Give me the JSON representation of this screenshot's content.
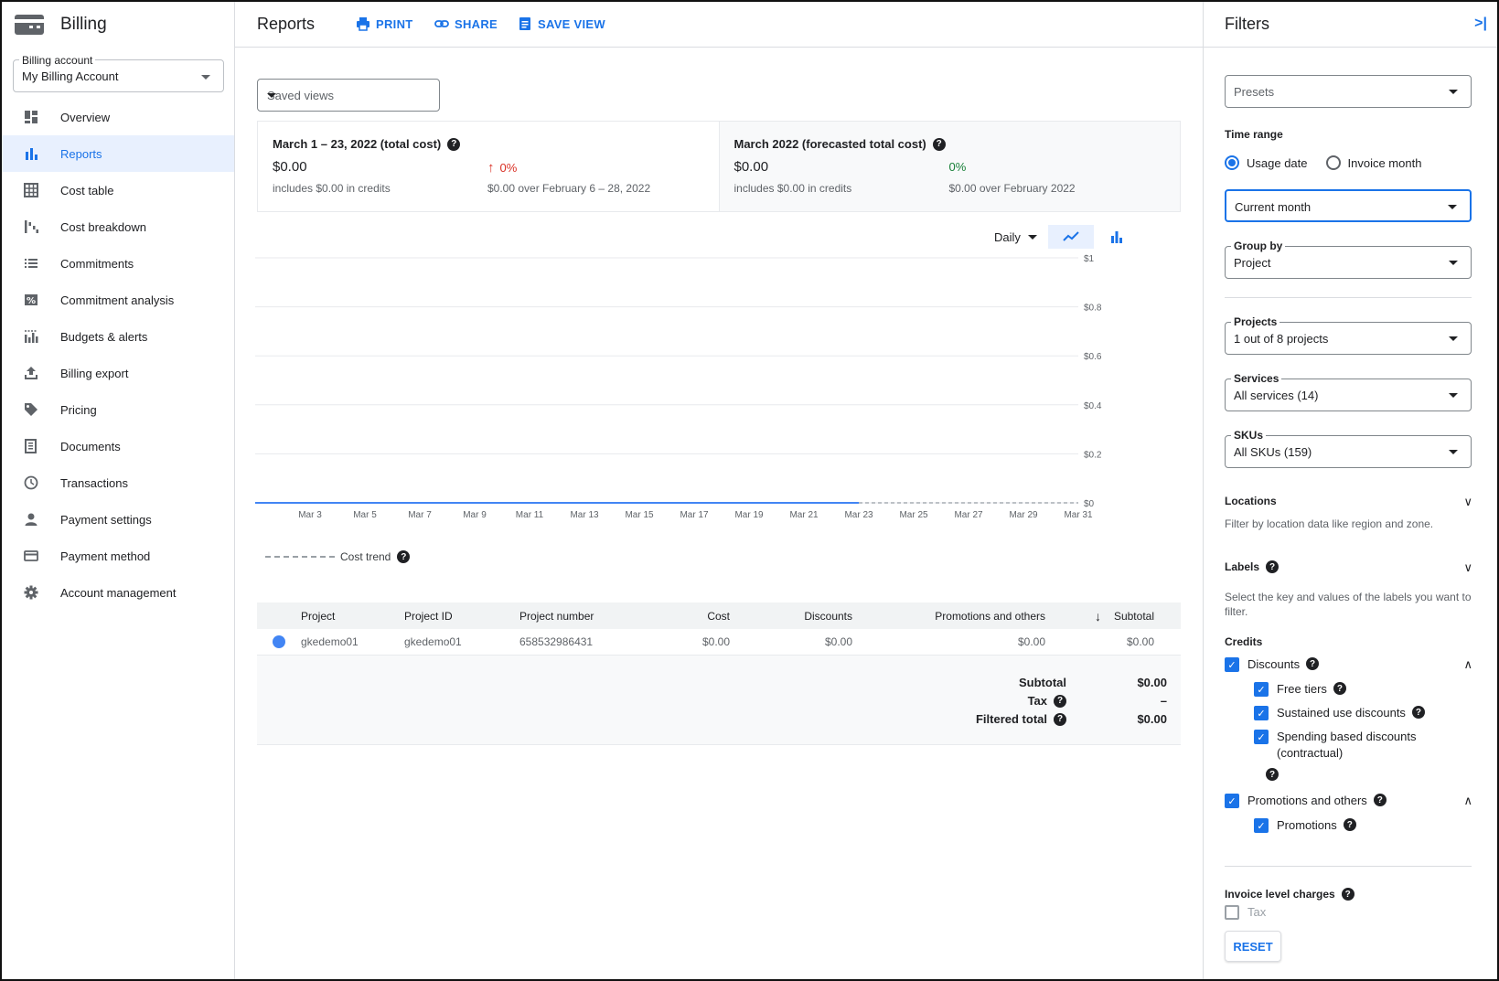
{
  "app": {
    "title": "Billing"
  },
  "billing_account": {
    "label": "Billing account",
    "value": "My Billing Account"
  },
  "sidebar": {
    "items": [
      {
        "label": "Overview",
        "icon": "dashboard-icon"
      },
      {
        "label": "Reports",
        "icon": "bar-chart-icon",
        "active": true
      },
      {
        "label": "Cost table",
        "icon": "table-icon"
      },
      {
        "label": "Cost breakdown",
        "icon": "waterfall-icon"
      },
      {
        "label": "Commitments",
        "icon": "list-icon"
      },
      {
        "label": "Commitment analysis",
        "icon": "percent-icon"
      },
      {
        "label": "Budgets & alerts",
        "icon": "budget-icon"
      },
      {
        "label": "Billing export",
        "icon": "upload-icon"
      },
      {
        "label": "Pricing",
        "icon": "tag-icon"
      },
      {
        "label": "Documents",
        "icon": "document-icon"
      },
      {
        "label": "Transactions",
        "icon": "clock-icon"
      },
      {
        "label": "Payment settings",
        "icon": "person-icon"
      },
      {
        "label": "Payment method",
        "icon": "credit-card-icon"
      },
      {
        "label": "Account management",
        "icon": "gear-icon"
      }
    ]
  },
  "header": {
    "title": "Reports",
    "print_label": "PRINT",
    "share_label": "SHARE",
    "save_view_label": "SAVE VIEW"
  },
  "saved_views": {
    "placeholder": "Saved views"
  },
  "summary": {
    "total": {
      "title": "March 1 – 23, 2022 (total cost)",
      "cost": "$0.00",
      "credits": "includes $0.00 in credits",
      "change": "0%",
      "compare": "$0.00 over February 6 – 28, 2022"
    },
    "forecast": {
      "title": "March 2022 (forecasted total cost)",
      "cost": "$0.00",
      "credits": "includes $0.00 in credits",
      "change": "0%",
      "compare": "$0.00 over February 2022"
    }
  },
  "chart_controls": {
    "granularity": "Daily"
  },
  "chart_data": {
    "type": "line",
    "x": [
      "Mar 1",
      "Mar 2",
      "Mar 3",
      "Mar 4",
      "Mar 5",
      "Mar 6",
      "Mar 7",
      "Mar 8",
      "Mar 9",
      "Mar 10",
      "Mar 11",
      "Mar 12",
      "Mar 13",
      "Mar 14",
      "Mar 15",
      "Mar 16",
      "Mar 17",
      "Mar 18",
      "Mar 19",
      "Mar 20",
      "Mar 21",
      "Mar 22",
      "Mar 23",
      "Mar 24",
      "Mar 25",
      "Mar 26",
      "Mar 27",
      "Mar 28",
      "Mar 29",
      "Mar 30",
      "Mar 31"
    ],
    "x_tick_labels": [
      "Mar 3",
      "Mar 5",
      "Mar 7",
      "Mar 9",
      "Mar 11",
      "Mar 13",
      "Mar 15",
      "Mar 17",
      "Mar 19",
      "Mar 21",
      "Mar 23",
      "Mar 25",
      "Mar 27",
      "Mar 29",
      "Mar 31"
    ],
    "y_tick_labels": [
      "$1",
      "$0.8",
      "$0.6",
      "$0.4",
      "$0.2",
      "$0"
    ],
    "ylim": [
      0,
      1
    ],
    "series": [
      {
        "values": [
          0,
          0,
          0,
          0,
          0,
          0,
          0,
          0,
          0,
          0,
          0,
          0,
          0,
          0,
          0,
          0,
          0,
          0,
          0,
          0,
          0,
          0,
          0
        ],
        "color": "#4285f4",
        "style": "solid"
      },
      {
        "name": "Cost trend",
        "values": [
          null,
          null,
          null,
          null,
          null,
          null,
          null,
          null,
          null,
          null,
          null,
          null,
          null,
          null,
          null,
          null,
          null,
          null,
          null,
          null,
          null,
          null,
          0,
          0,
          0,
          0,
          0,
          0,
          0,
          0,
          0
        ],
        "color": "#bdc1c6",
        "style": "dashed"
      }
    ],
    "grid": true,
    "legend": "bottom-left"
  },
  "table": {
    "columns": [
      "Project",
      "Project ID",
      "Project number",
      "Cost",
      "Discounts",
      "Promotions and others",
      "Subtotal"
    ],
    "rows": [
      {
        "project": "gkedemo01",
        "project_id": "gkedemo01",
        "project_number": "658532986431",
        "cost": "$0.00",
        "discounts": "$0.00",
        "promotions": "$0.00",
        "subtotal": "$0.00"
      }
    ],
    "totals": {
      "subtotal_label": "Subtotal",
      "subtotal": "$0.00",
      "tax_label": "Tax",
      "tax": "–",
      "filtered_label": "Filtered total",
      "filtered": "$0.00"
    }
  },
  "filters": {
    "title": "Filters",
    "presets_placeholder": "Presets",
    "time_range_label": "Time range",
    "usage_date_label": "Usage date",
    "invoice_month_label": "Invoice month",
    "time_range_value": "Current month",
    "group_by_label": "Group by",
    "group_by_value": "Project",
    "projects_label": "Projects",
    "projects_value": "1 out of 8 projects",
    "services_label": "Services",
    "services_value": "All services (14)",
    "skus_label": "SKUs",
    "skus_value": "All SKUs (159)",
    "locations_label": "Locations",
    "locations_desc": "Filter by location data like region and zone.",
    "labels_label": "Labels",
    "labels_desc": "Select the key and values of the labels you want to filter.",
    "credits_label": "Credits",
    "discounts_label": "Discounts",
    "free_tiers_label": "Free tiers",
    "sustained_label": "Sustained use discounts",
    "spending_label": "Spending based discounts (contractual)",
    "promotions_others_label": "Promotions and others",
    "promotions_label": "Promotions",
    "invoice_charges_label": "Invoice level charges",
    "tax_label": "Tax",
    "reset_label": "RESET"
  }
}
